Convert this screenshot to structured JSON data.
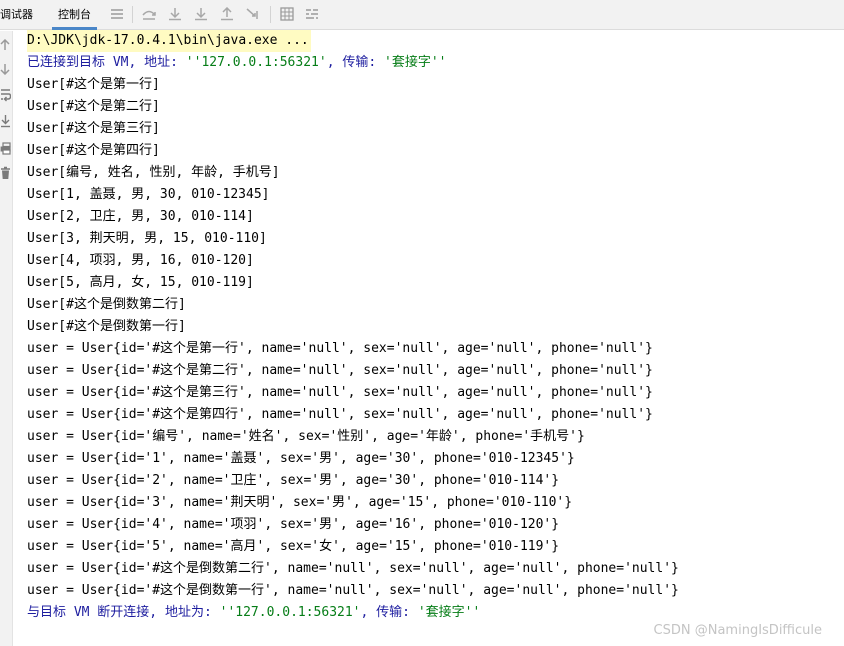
{
  "toolbar": {
    "tabs": [
      {
        "label": "调试器"
      },
      {
        "label": "控制台"
      }
    ],
    "icons": [
      "menu-icon",
      "step-over-icon",
      "step-into-icon",
      "force-step-into-icon",
      "step-out-icon",
      "run-to-cursor-icon",
      "evaluate-icon",
      "trace-icon"
    ]
  },
  "gutter": {
    "icons": [
      "up-arrow-icon",
      "down-arrow-icon",
      "soft-wrap-icon",
      "scroll-to-end-icon",
      "print-icon",
      "trash-icon"
    ]
  },
  "console": {
    "command": "D:\\JDK\\jdk-17.0.4.1\\bin\\java.exe ...",
    "connected": {
      "prefix": "已连接到目标 VM, 地址: ",
      "address": "''127.0.0.1:56321'",
      "mid": ", 传输: ",
      "transport": "'套接字''"
    },
    "lines": [
      "User[#这个是第一行]",
      "User[#这个是第二行]",
      "User[#这个是第三行]",
      "User[#这个是第四行]",
      "User[编号, 姓名, 性别, 年龄, 手机号]",
      "User[1, 盖聂, 男, 30, 010-12345]",
      "User[2, 卫庄, 男, 30, 010-114]",
      "User[3, 荆天明, 男, 15, 010-110]",
      "User[4, 项羽, 男, 16, 010-120]",
      "User[5, 高月, 女, 15, 010-119]",
      "User[#这个是倒数第二行]",
      "User[#这个是倒数第一行]",
      "user = User{id='#这个是第一行', name='null', sex='null', age='null', phone='null'}",
      "user = User{id='#这个是第二行', name='null', sex='null', age='null', phone='null'}",
      "user = User{id='#这个是第三行', name='null', sex='null', age='null', phone='null'}",
      "user = User{id='#这个是第四行', name='null', sex='null', age='null', phone='null'}",
      "user = User{id='编号', name='姓名', sex='性别', age='年龄', phone='手机号'}",
      "user = User{id='1', name='盖聂', sex='男', age='30', phone='010-12345'}",
      "user = User{id='2', name='卫庄', sex='男', age='30', phone='010-114'}",
      "user = User{id='3', name='荆天明', sex='男', age='15', phone='010-110'}",
      "user = User{id='4', name='项羽', sex='男', age='16', phone='010-120'}",
      "user = User{id='5', name='高月', sex='女', age='15', phone='010-119'}",
      "user = User{id='#这个是倒数第二行', name='null', sex='null', age='null', phone='null'}",
      "user = User{id='#这个是倒数第一行', name='null', sex='null', age='null', phone='null'}"
    ],
    "disconnected": {
      "prefix": "与目标 VM 断开连接, 地址为: ",
      "address": "''127.0.0.1:56321'",
      "mid": ", 传输: ",
      "transport": "'套接字''"
    }
  },
  "watermark": "CSDN @NamingIsDifficule",
  "colors": {
    "system_text": "#1d1d9f",
    "string_text": "#067d17",
    "command_highlight": "#fffbc2",
    "tab_underline": "#4a86c8"
  }
}
